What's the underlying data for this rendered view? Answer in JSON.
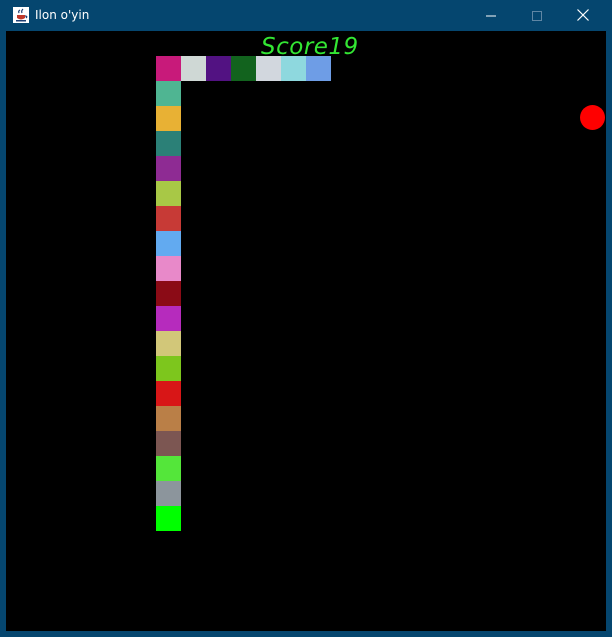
{
  "window": {
    "title": "Ilon o'yin",
    "app_icon": "java-cup-icon",
    "buttons": {
      "minimize_icon": "minimize-icon",
      "maximize_icon": "maximize-icon",
      "close_icon": "close-icon"
    },
    "titlebar_color": "#05466f"
  },
  "game": {
    "score_text": "Score19",
    "score_color": "#33e633",
    "background_color": "#000000",
    "food": {
      "color": "#ff0000",
      "col": 23,
      "row": 3
    },
    "snake": {
      "cell_units": "grid cells",
      "segments": [
        {
          "col": 6,
          "row": 1,
          "color": "#c81a7a"
        },
        {
          "col": 7,
          "row": 1,
          "color": "#cfd8d5"
        },
        {
          "col": 8,
          "row": 1,
          "color": "#521282"
        },
        {
          "col": 9,
          "row": 1,
          "color": "#12631e"
        },
        {
          "col": 10,
          "row": 1,
          "color": "#d2d7de"
        },
        {
          "col": 11,
          "row": 1,
          "color": "#8ed8de"
        },
        {
          "col": 12,
          "row": 1,
          "color": "#6e9de6"
        },
        {
          "col": 6,
          "row": 2,
          "color": "#4fb592"
        },
        {
          "col": 6,
          "row": 3,
          "color": "#e8b134"
        },
        {
          "col": 6,
          "row": 4,
          "color": "#2b8077"
        },
        {
          "col": 6,
          "row": 5,
          "color": "#8e2b93"
        },
        {
          "col": 6,
          "row": 6,
          "color": "#a8c846"
        },
        {
          "col": 6,
          "row": 7,
          "color": "#c73a36"
        },
        {
          "col": 6,
          "row": 8,
          "color": "#62aaf0"
        },
        {
          "col": 6,
          "row": 9,
          "color": "#e889c9"
        },
        {
          "col": 6,
          "row": 10,
          "color": "#8b0b16"
        },
        {
          "col": 6,
          "row": 11,
          "color": "#b62bbd"
        },
        {
          "col": 6,
          "row": 12,
          "color": "#d2c779"
        },
        {
          "col": 6,
          "row": 13,
          "color": "#7dc61d"
        },
        {
          "col": 6,
          "row": 14,
          "color": "#d81617"
        },
        {
          "col": 6,
          "row": 15,
          "color": "#ba7f47"
        },
        {
          "col": 6,
          "row": 16,
          "color": "#7c5652"
        },
        {
          "col": 6,
          "row": 17,
          "color": "#54e63a"
        },
        {
          "col": 6,
          "row": 18,
          "color": "#8c959c"
        },
        {
          "col": 6,
          "row": 19,
          "color": "#00ff00"
        }
      ]
    }
  }
}
